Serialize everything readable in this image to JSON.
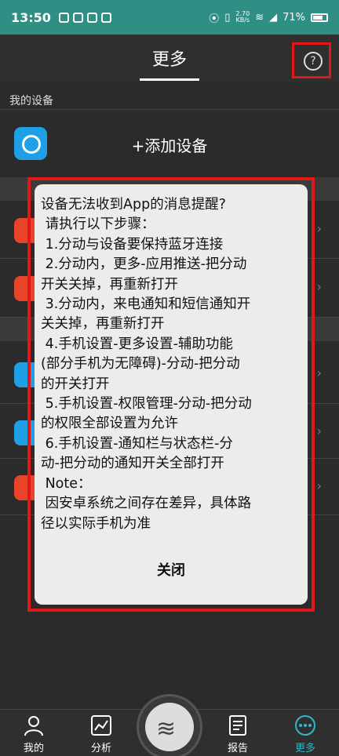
{
  "status_bar": {
    "time": "13:50",
    "speed_value": "2.70",
    "speed_unit": "KB/s",
    "battery": "71%"
  },
  "header": {
    "title": "更多",
    "help_icon": "?"
  },
  "devices_section": {
    "label": "我的设备",
    "add_label": "+添加设备"
  },
  "dialog": {
    "message": "设备无法收到App的消息提醒?\n 请执行以下步骤：\n 1.分动与设备要保持蓝牙连接\n 2.分动内，更多-应用推送-把分动\n开关关掉，再重新打开\n 3.分动内，来电通知和短信通知开\n关关掉，再重新打开\n 4.手机设置-更多设置-辅助功能\n(部分手机为无障碍)-分动-把分动\n的开关打开\n 5.手机设置-权限管理-分动-把分动\n的权限全部设置为允许\n 6.手机设置-通知栏与状态栏-分\n动-把分动的通知开关全部打开\n Note：\n 因安卓系统之间存在差异，具体路\n径以实际手机为准",
    "close_label": "关闭"
  },
  "tabs": [
    {
      "label": "我的",
      "icon": "person-icon"
    },
    {
      "label": "分析",
      "icon": "chart-icon"
    },
    {
      "label": "报告",
      "icon": "document-icon"
    },
    {
      "label": "更多",
      "icon": "more-icon",
      "active": true
    }
  ],
  "colors": {
    "accent": "#2fb8c8",
    "status_bar": "#2f8f84",
    "highlight": "#e01818"
  }
}
